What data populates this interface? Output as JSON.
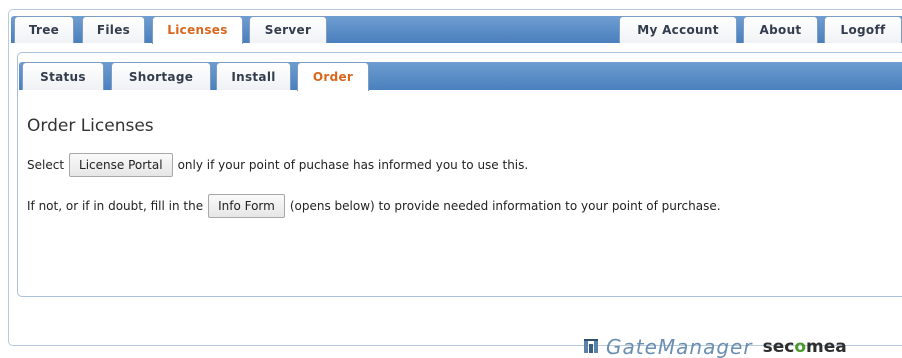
{
  "top_tabs": [
    {
      "label": "Tree",
      "active": false
    },
    {
      "label": "Files",
      "active": false
    },
    {
      "label": "Licenses",
      "active": true
    },
    {
      "label": "Server",
      "active": false
    }
  ],
  "right_tabs": [
    {
      "label": "My Account"
    },
    {
      "label": "About"
    },
    {
      "label": "Logoff"
    }
  ],
  "sub_tabs": [
    {
      "label": "Status",
      "active": false
    },
    {
      "label": "Shortage",
      "active": false
    },
    {
      "label": "Install",
      "active": false
    },
    {
      "label": "Order",
      "active": true
    }
  ],
  "content": {
    "heading": "Order Licenses",
    "line1": {
      "before": "Select",
      "button": "License Portal",
      "after": "only if your point of puchase has informed you to use this."
    },
    "line2": {
      "before": "If not, or if in doubt, fill in the",
      "button": "Info Form",
      "after": "(opens below) to provide needed information to your point of purchase."
    }
  },
  "footer": {
    "product": "GateManager",
    "brand_pre": "sec",
    "brand_o": "o",
    "brand_post": "mea"
  },
  "colors": {
    "tab_bar": "#4a7fbd",
    "active_tab_text": "#d9661e",
    "tab_text": "#333d4d",
    "brand_green": "#4a9a2d",
    "gatemanager_blue": "#6b8fb0"
  },
  "icons": {
    "gatemanager_logo": "gatemanager-logo-icon"
  }
}
